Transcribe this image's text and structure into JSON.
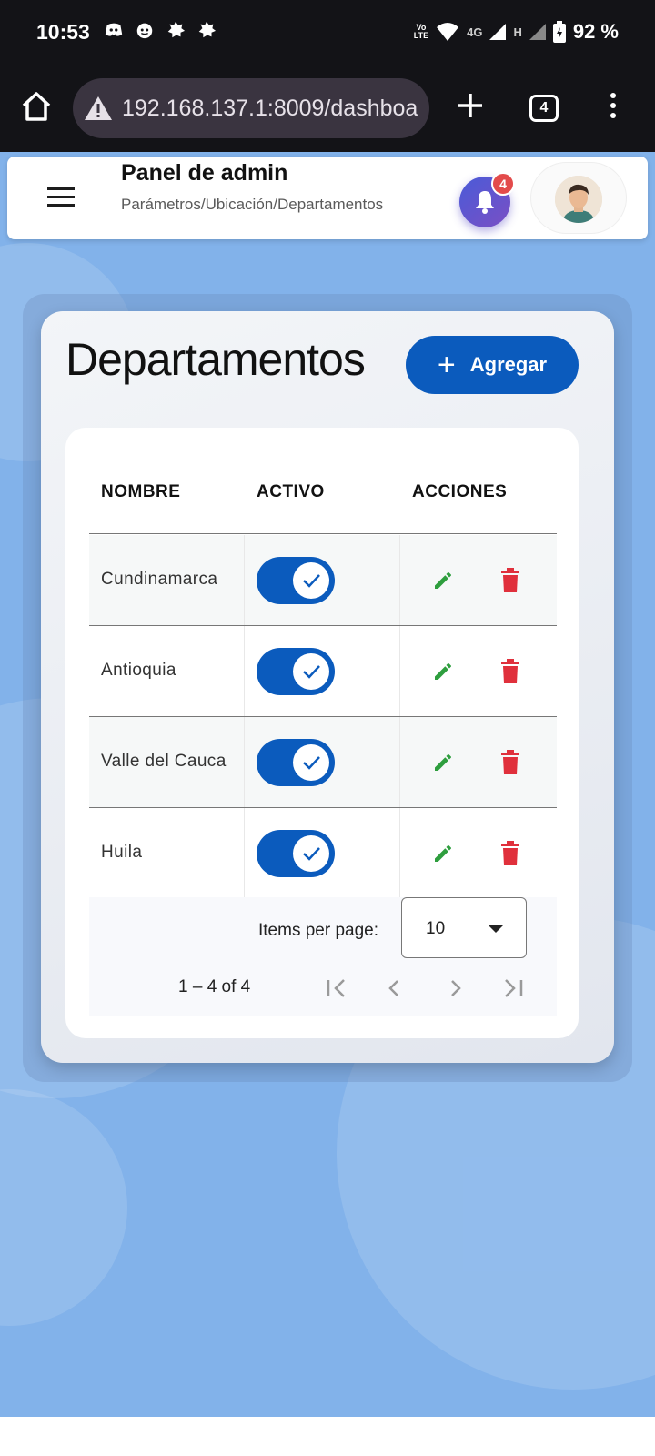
{
  "status": {
    "time": "10:53",
    "volte_line1": "Vo",
    "volte_line2": "LTE",
    "net1": "4G",
    "net2": "H",
    "battery": "92 %"
  },
  "browser": {
    "url": "192.168.137.1:8009/dashboa",
    "tab_count": "4"
  },
  "header": {
    "title": "Panel de admin",
    "breadcrumb": "Parámetros/Ubicación/Departamentos",
    "notification_count": "4"
  },
  "main": {
    "heading": "Departamentos",
    "add_label": "Agregar",
    "add_symbol": "+",
    "columns": [
      "NOMBRE",
      "ACTIVO",
      "ACCIONES"
    ],
    "rows": [
      {
        "name": "Cundinamarca",
        "active": true
      },
      {
        "name": "Antioquia",
        "active": true
      },
      {
        "name": "Valle del Cauca",
        "active": true
      },
      {
        "name": "Huila",
        "active": true
      }
    ]
  },
  "paginator": {
    "items_per_page_label": "Items per page:",
    "items_per_page_value": "10",
    "range_label": "1 – 4 of 4"
  },
  "colors": {
    "primary": "#0b5bbd",
    "edit": "#2e9e3e",
    "delete": "#e0303c",
    "background": "#82b2ea"
  },
  "icons": {
    "home": "home-icon",
    "warning": "warning-icon",
    "bell": "bell-icon",
    "edit": "pencil-icon",
    "delete": "trash-icon",
    "check": "check-icon"
  }
}
